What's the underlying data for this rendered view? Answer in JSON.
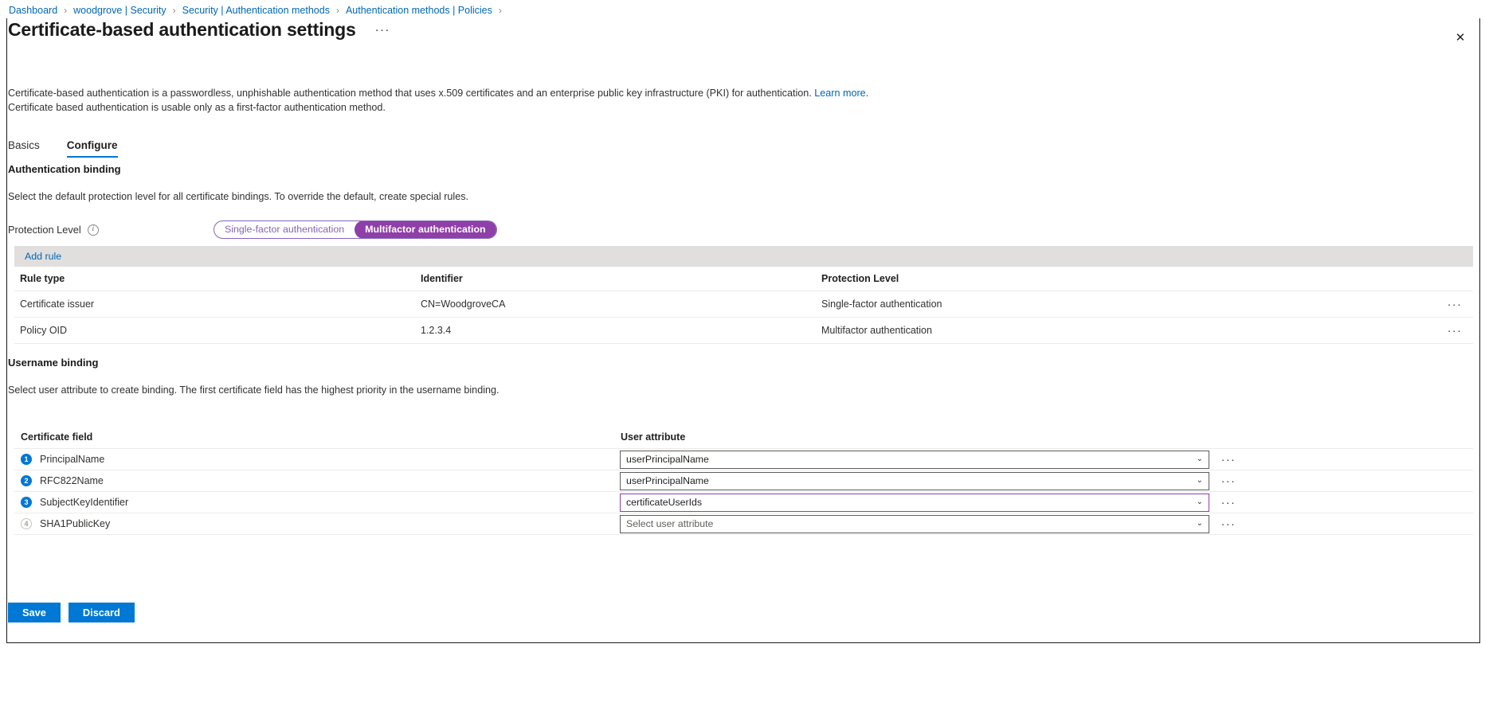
{
  "breadcrumb": {
    "separator": "›",
    "items": [
      {
        "label": "Dashboard"
      },
      {
        "label": "woodgrove | Security"
      },
      {
        "label": "Security | Authentication methods"
      },
      {
        "label": "Authentication methods | Policies"
      }
    ]
  },
  "header": {
    "title": "Certificate-based authentication settings",
    "more_label": "···",
    "close_label": "✕"
  },
  "description": {
    "line1_before_link": "Certificate-based authentication is a passwordless, unphishable authentication method that uses x.509 certificates and an enterprise public key infrastructure (PKI) for authentication. ",
    "link_label": "Learn more",
    "line1_after_link": ".",
    "line2": "Certificate based authentication is usable only as a first-factor authentication method."
  },
  "tabs": [
    {
      "label": "Basics",
      "selected": false
    },
    {
      "label": "Configure",
      "selected": true
    }
  ],
  "authentication_binding": {
    "heading": "Authentication binding",
    "subtext": "Select the default protection level for all certificate bindings. To override the default, create special rules.",
    "protection_level_label": "Protection Level",
    "info_glyph": "i",
    "options": [
      {
        "label": "Single-factor authentication",
        "selected": false
      },
      {
        "label": "Multifactor authentication",
        "selected": true
      }
    ],
    "accent_color": "#8f3fa8",
    "toolbar": {
      "add_rule_label": "Add rule"
    },
    "columns": [
      "Rule type",
      "Identifier",
      "Protection Level"
    ],
    "rows": [
      {
        "rule_type": "Certificate issuer",
        "identifier": "CN=WoodgroveCA",
        "protection_level": "Single-factor authentication",
        "menu": "···"
      },
      {
        "rule_type": "Policy OID",
        "identifier": "1.2.3.4",
        "protection_level": "Multifactor authentication",
        "menu": "···"
      }
    ]
  },
  "username_binding": {
    "heading": "Username binding",
    "subtext": "Select user attribute to create binding. The first certificate field has the highest priority in the username binding.",
    "columns": [
      "Certificate field",
      "User attribute"
    ],
    "rows": [
      {
        "order": "1",
        "order_enabled": true,
        "certificate_field": "PrincipalName",
        "user_attribute": "userPrincipalName",
        "is_placeholder": false,
        "focused": false,
        "chevron": "⌄",
        "menu": "···"
      },
      {
        "order": "2",
        "order_enabled": true,
        "certificate_field": "RFC822Name",
        "user_attribute": "userPrincipalName",
        "is_placeholder": false,
        "focused": false,
        "chevron": "⌄",
        "menu": "···"
      },
      {
        "order": "3",
        "order_enabled": true,
        "certificate_field": "SubjectKeyIdentifier",
        "user_attribute": "certificateUserIds",
        "is_placeholder": false,
        "focused": true,
        "chevron": "⌄",
        "menu": "···"
      },
      {
        "order": "4",
        "order_enabled": false,
        "certificate_field": "SHA1PublicKey",
        "user_attribute": "Select user attribute",
        "is_placeholder": true,
        "focused": false,
        "chevron": "⌄",
        "menu": "···"
      }
    ]
  },
  "footer": {
    "save_label": "Save",
    "discard_label": "Discard",
    "primary_color": "#0078d4"
  }
}
